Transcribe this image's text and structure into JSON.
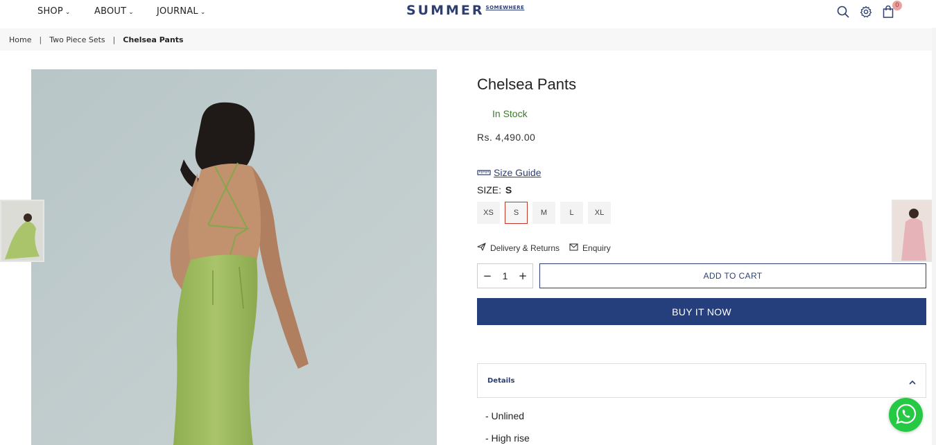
{
  "header": {
    "nav": [
      {
        "label": "SHOP"
      },
      {
        "label": "ABOUT"
      },
      {
        "label": "JOURNAL"
      }
    ],
    "logo_main": "SUMMER",
    "logo_sub": "SOMEWHERE",
    "cart_count": "0",
    "icons": [
      "search-icon",
      "gear-icon",
      "shopping-bag-icon"
    ]
  },
  "breadcrumb": {
    "items": [
      "Home",
      "Two Piece Sets"
    ],
    "current": "Chelsea Pants"
  },
  "product": {
    "title": "Chelsea Pants",
    "stock": "In Stock",
    "price": "Rs. 4,490.00",
    "size_guide": "Size Guide",
    "size_label": "SIZE:",
    "selected_size": "S",
    "sizes": [
      "XS",
      "S",
      "M",
      "L",
      "XL"
    ],
    "delivery": "Delivery & Returns",
    "enquiry": "Enquiry",
    "quantity": "1",
    "add_to_cart": "ADD TO CART",
    "buy_now": "BUY IT NOW",
    "details_label": "Details",
    "details": [
      "- Unlined",
      "- High rise"
    ]
  },
  "colors": {
    "brand": "#2c3e73",
    "buy_button": "#253f7c",
    "stock_green": "#3a7a2a",
    "selected_size_border": "#c0392b",
    "whatsapp": "#26c943"
  }
}
